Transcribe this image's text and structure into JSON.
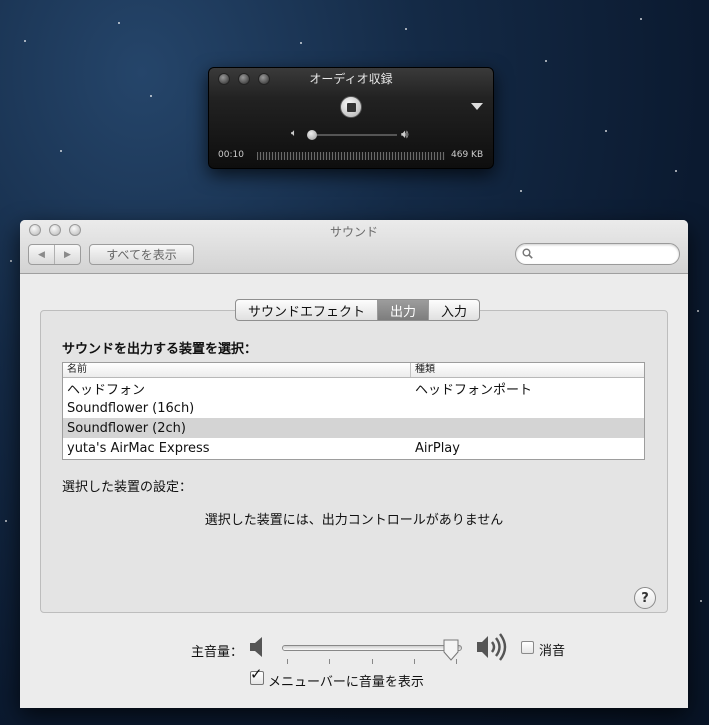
{
  "recorder": {
    "title": "オーディオ収録",
    "elapsed": "00:10",
    "file_size": "469 KB"
  },
  "window": {
    "title": "サウンド",
    "show_all": "すべてを表示",
    "search_placeholder": ""
  },
  "tabs": [
    {
      "label": "サウンドエフェクト",
      "active": false
    },
    {
      "label": "出力",
      "active": true
    },
    {
      "label": "入力",
      "active": false
    }
  ],
  "output": {
    "section_title": "サウンドを出力する装置を選択：",
    "columns": {
      "name": "名前",
      "type": "種類"
    },
    "devices": [
      {
        "name": "ヘッドフォン",
        "type": "ヘッドフォンポート",
        "selected": false
      },
      {
        "name": "Soundflower (16ch)",
        "type": "",
        "selected": false
      },
      {
        "name": "Soundflower (2ch)",
        "type": "",
        "selected": true
      },
      {
        "name": "yuta's AirMac Express",
        "type": "AirPlay",
        "selected": false
      }
    ],
    "settings_label": "選択した装置の設定：",
    "no_controls_message": "選択した装置には、出力コントロールがありません"
  },
  "help_label": "?",
  "volume": {
    "label": "主音量：",
    "level": 0.98,
    "mute_label": "消音",
    "mute_checked": false,
    "menubar_label": "メニューバーに音量を表示",
    "menubar_checked": true
  },
  "icons": {
    "stop": "stop-icon",
    "dropdown": "chevron-down-icon",
    "speaker_low": "speaker-low-icon",
    "speaker_high": "speaker-high-icon",
    "search": "search-icon",
    "help": "help-icon"
  }
}
